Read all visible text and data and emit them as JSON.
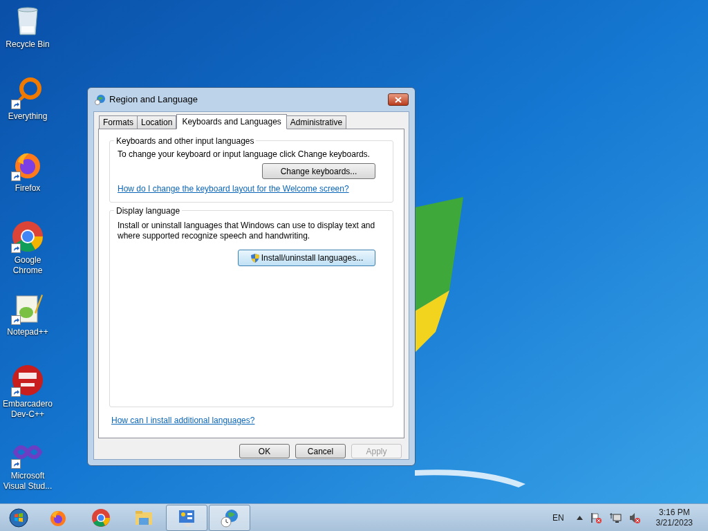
{
  "desktop_icons": [
    {
      "label": "Recycle Bin",
      "shortcut": false
    },
    {
      "label": "Everything",
      "shortcut": true
    },
    {
      "label": "Firefox",
      "shortcut": true
    },
    {
      "label": "Google Chrome",
      "shortcut": true
    },
    {
      "label": "Notepad++",
      "shortcut": true
    },
    {
      "label": "Embarcadero Dev-C++",
      "shortcut": true
    },
    {
      "label": "Microsoft Visual Stud...",
      "shortcut": true
    }
  ],
  "window": {
    "title": "Region and Language",
    "tabs": [
      {
        "label": "Formats",
        "selected": false
      },
      {
        "label": "Location",
        "selected": false
      },
      {
        "label": "Keyboards and Languages",
        "selected": true
      },
      {
        "label": "Administrative",
        "selected": false
      }
    ],
    "keyboards_group": {
      "heading": "Keyboards and other input languages",
      "text": "To change your keyboard or input language click Change keyboards.",
      "button": "Change keyboards...",
      "link": "How do I change the keyboard layout for the Welcome screen?"
    },
    "display_group": {
      "heading": "Display language",
      "text": "Install or uninstall languages that Windows can use to display text and where supported recognize speech and handwriting.",
      "button": "Install/uninstall languages..."
    },
    "link": "How can I install additional languages?",
    "buttons": [
      {
        "label": "OK",
        "disabled": false
      },
      {
        "label": "Cancel",
        "disabled": false
      },
      {
        "label": "Apply",
        "disabled": true
      }
    ]
  },
  "taskbar": {
    "items": [
      {
        "open": false
      },
      {
        "open": false
      },
      {
        "open": false
      },
      {
        "open": true
      },
      {
        "open": true
      }
    ],
    "language": "EN",
    "time": "3:16 PM",
    "date": "3/21/2023"
  }
}
